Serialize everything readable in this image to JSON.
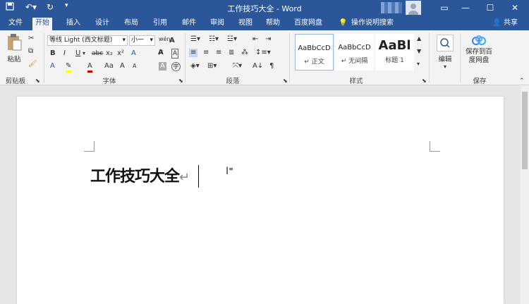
{
  "window": {
    "title": "工作技巧大全 - Word",
    "min_icon": "minimize-icon",
    "max_icon": "maximize-icon",
    "close_icon": "close-icon",
    "ribbon_display_icon": "ribbon-display-icon"
  },
  "quick_access": [
    "save-icon",
    "undo-icon",
    "redo-icon",
    "customize-icon"
  ],
  "tabs": [
    "文件",
    "开始",
    "插入",
    "设计",
    "布局",
    "引用",
    "邮件",
    "审阅",
    "视图",
    "帮助",
    "百度网盘"
  ],
  "active_tab": "开始",
  "tell_me": "操作说明搜索",
  "share": "共享",
  "clipboard": {
    "paste": "粘贴",
    "label": "剪贴板"
  },
  "font": {
    "name": "等线 Light (西文标题)",
    "size": "小一",
    "label": "字体",
    "row2": [
      "B",
      "I",
      "U",
      "abc",
      "x₂",
      "x²",
      "A"
    ],
    "row3": [
      "A",
      "A",
      "Aa",
      "A",
      "A",
      "A"
    ]
  },
  "paragraph": {
    "label": "段落"
  },
  "styles": {
    "label": "样式",
    "cards": [
      {
        "preview": "AaBbCcD",
        "name": "↵ 正文"
      },
      {
        "preview": "AaBbCcD",
        "name": "↵ 无间隔"
      },
      {
        "preview": "AaBl",
        "name": "标题 1"
      }
    ]
  },
  "editing": {
    "label": "编辑"
  },
  "save_cloud": {
    "button": "保存到百度网盘",
    "label": "保存"
  },
  "document": {
    "heading": "工作技巧大全",
    "para_mark": "↵"
  }
}
